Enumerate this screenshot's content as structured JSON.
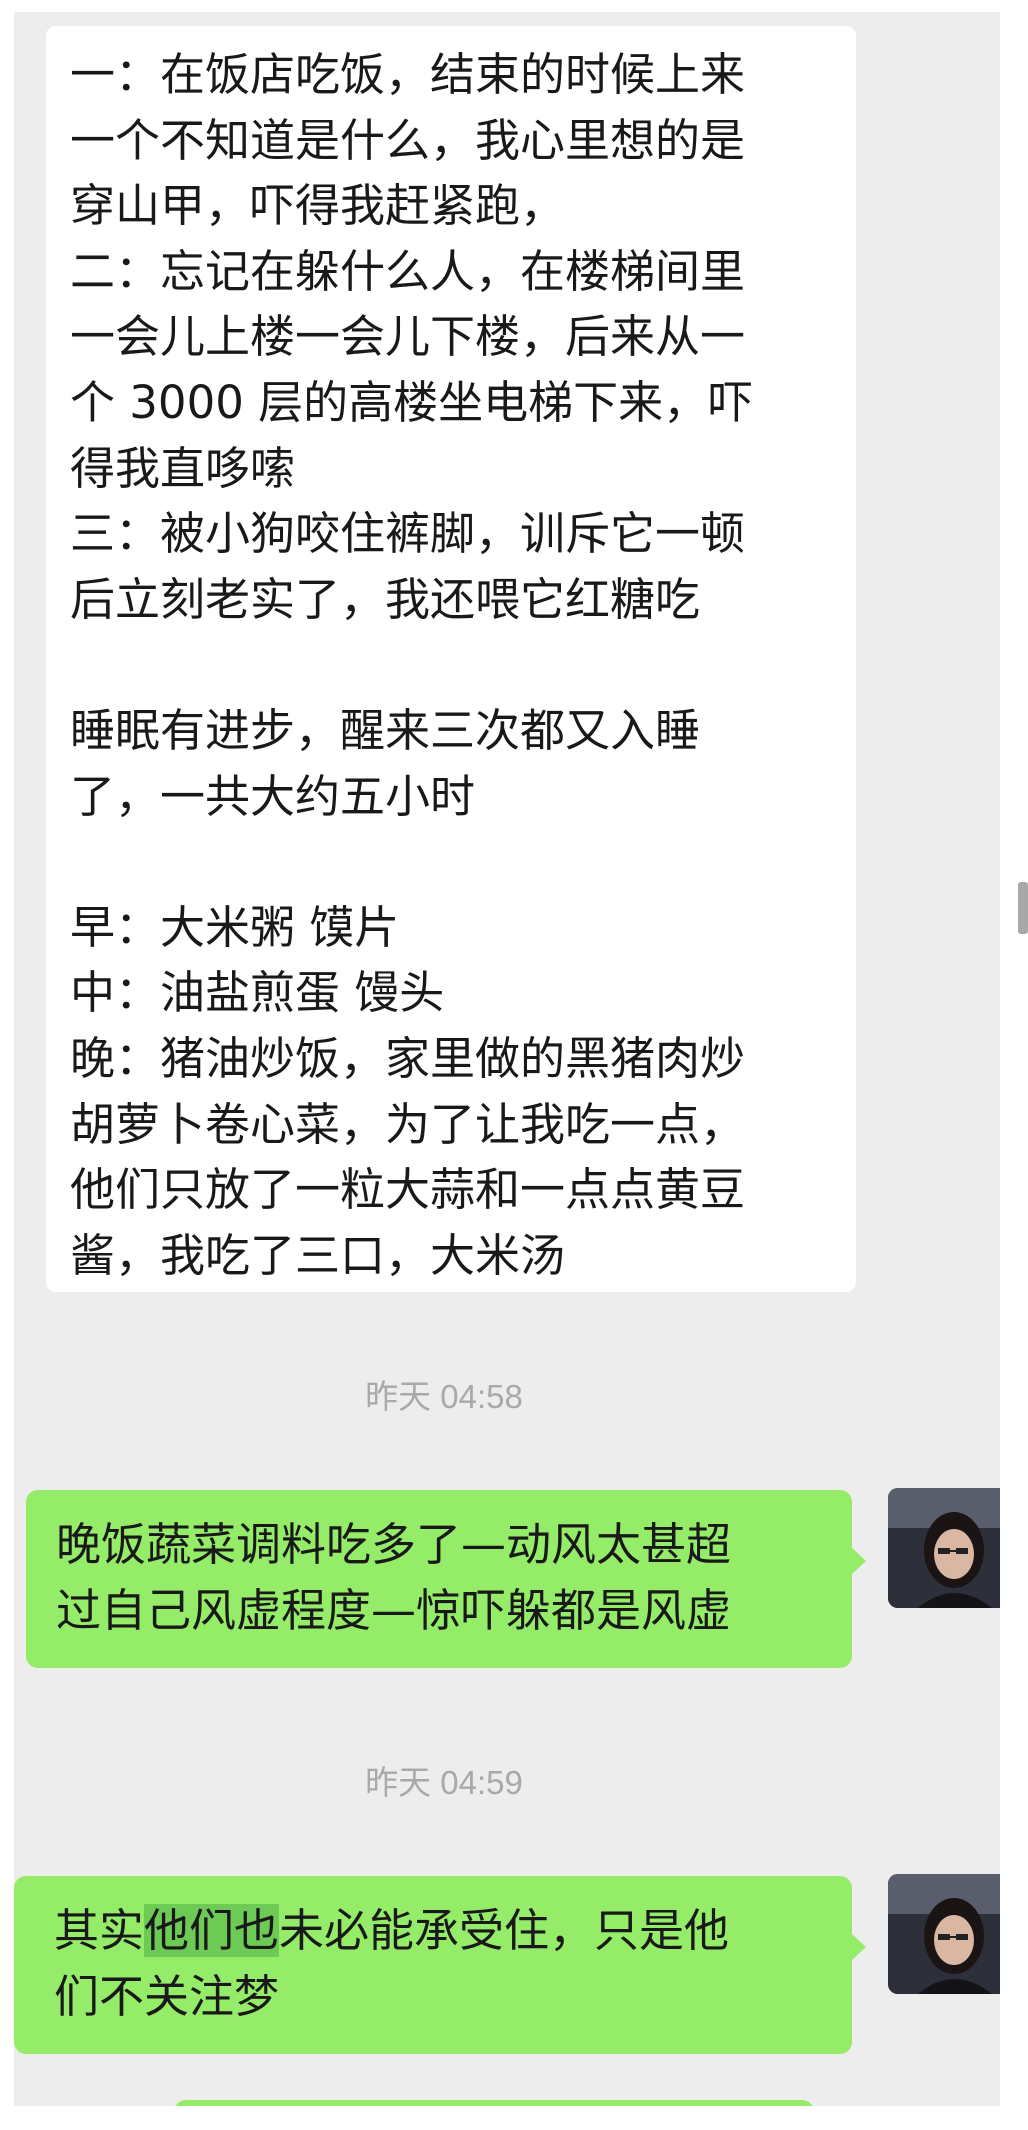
{
  "messages": {
    "received_lines": [
      "一：在饭店吃饭，结束的时候上来",
      "一个不知道是什么，我心里想的是",
      "穿山甲，吓得我赶紧跑，",
      "二：忘记在躲什么人，在楼梯间里",
      "一会儿上楼一会儿下楼，后来从一",
      "个 3000 层的高楼坐电梯下来，吓",
      "得我直哆嗦",
      "三：被小狗咬住裤脚，训斥它一顿",
      "后立刻老实了，我还喂它红糖吃",
      "",
      "睡眠有进步，醒来三次都又入睡",
      "了，一共大约五小时",
      "",
      "早：大米粥 馍片",
      "中：油盐煎蛋 馒头",
      "晚：猪油炒饭，家里做的黑猪肉炒",
      "胡萝卜卷心菜，为了让我吃一点，",
      "他们只放了一粒大蒜和一点点黄豆",
      "酱，我吃了三口，大米汤"
    ],
    "timestamp_1": "昨天 04:58",
    "sent_1_lines": [
      "晚饭蔬菜调料吃多了—动风太甚超",
      "过自己风虚程度—惊吓躲都是风虚"
    ],
    "timestamp_2": "昨天 04:59",
    "sent_2": {
      "prefix": "其实",
      "highlight": "他们也",
      "suffix": "未必能承受住，只是他",
      "line2": "们不关注梦"
    }
  },
  "colors": {
    "chat_background": "#ededed",
    "sent_bubble": "#95ec69",
    "received_bubble": "#ffffff",
    "selection_highlight": "#6dcb55",
    "timestamp_text": "#a9a9a9"
  },
  "icons": {
    "avatar": "user-avatar-photo"
  }
}
